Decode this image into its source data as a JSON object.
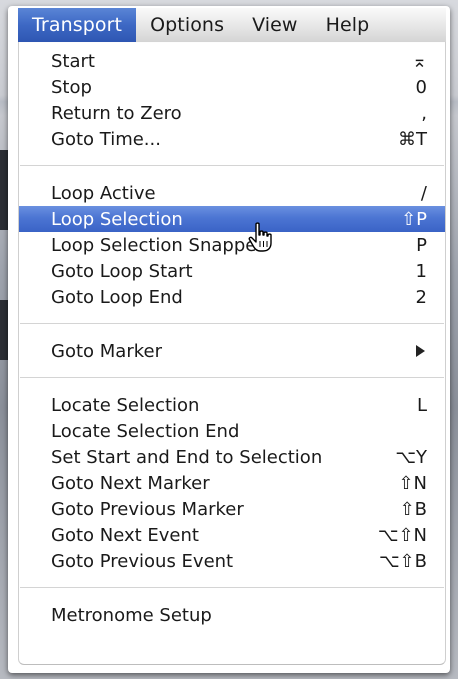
{
  "menubar": {
    "items": [
      {
        "label": "Transport",
        "active": true
      },
      {
        "label": "Options"
      },
      {
        "label": "View"
      },
      {
        "label": "Help"
      }
    ]
  },
  "menu": {
    "items": [
      {
        "label": "Start",
        "shortcut": "⌅"
      },
      {
        "label": "Stop",
        "shortcut": "0"
      },
      {
        "label": "Return to Zero",
        "shortcut": ","
      },
      {
        "label": "Goto Time...",
        "shortcut": "⌘T"
      },
      {
        "label": "Loop Active",
        "shortcut": "/"
      },
      {
        "label": "Loop Selection",
        "shortcut": "⇧P",
        "highlighted": true
      },
      {
        "label": "Loop Selection Snapped",
        "shortcut": "P"
      },
      {
        "label": "Goto Loop Start",
        "shortcut": "1"
      },
      {
        "label": "Goto Loop End",
        "shortcut": "2"
      },
      {
        "label": "Goto Marker",
        "submenu_icon": "triangle-right-icon"
      },
      {
        "label": "Locate Selection",
        "shortcut": "L"
      },
      {
        "label": "Locate Selection End",
        "shortcut": ""
      },
      {
        "label": "Set Start and End to Selection",
        "shortcut": "⌥Y"
      },
      {
        "label": "Goto Next Marker",
        "shortcut": "⇧N"
      },
      {
        "label": "Goto Previous Marker",
        "shortcut": "⇧B"
      },
      {
        "label": "Goto Next Event",
        "shortcut": "⌥⇧N"
      },
      {
        "label": "Goto Previous Event",
        "shortcut": "⌥⇧B"
      },
      {
        "label": "Metronome Setup",
        "shortcut": ""
      }
    ]
  },
  "cursor": {
    "icon": "pointing-hand-cursor-icon"
  },
  "colors": {
    "highlight": "#4c75d3",
    "menubar_active": "#3d68c4"
  }
}
